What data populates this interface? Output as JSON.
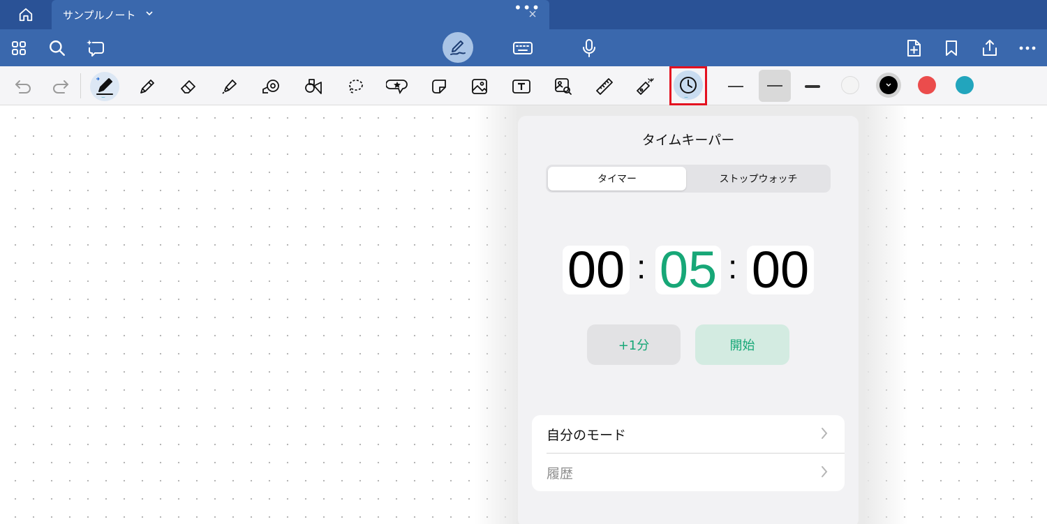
{
  "tabbar": {
    "tab_title": "サンプルノート",
    "tab_more": "•••"
  },
  "mainbar": {
    "left_icons": [
      "grid-icon",
      "search-icon",
      "ai-assist-icon"
    ],
    "center_icons": [
      "handwriting-icon",
      "keyboard-icon",
      "microphone-icon"
    ],
    "right_icons": [
      "add-page-icon",
      "bookmark-icon",
      "share-icon",
      "more-icon"
    ]
  },
  "toolbar": {
    "tools": [
      "undo",
      "redo",
      "pen",
      "pencil",
      "eraser",
      "highlighter",
      "tape",
      "shapes",
      "lasso",
      "sticker",
      "sticky-note",
      "image",
      "text",
      "image-search",
      "ruler",
      "laser",
      "timer"
    ],
    "colors": {
      "white": "#f4f4f4",
      "black": "#000000",
      "red": "#eb4c4c",
      "teal": "#22a5bd",
      "accent": "#17a777"
    }
  },
  "timekeeper": {
    "title": "タイムキーパー",
    "segments": [
      "タイマー",
      "ストップウォッチ"
    ],
    "selected_segment": "タイマー",
    "time": {
      "hours": "00",
      "minutes": "05",
      "seconds": "00",
      "separator": ":"
    },
    "buttons": {
      "add_minute": "+1分",
      "start": "開始"
    },
    "menu": [
      {
        "label": "自分のモード"
      },
      {
        "label": "履歴"
      }
    ]
  }
}
